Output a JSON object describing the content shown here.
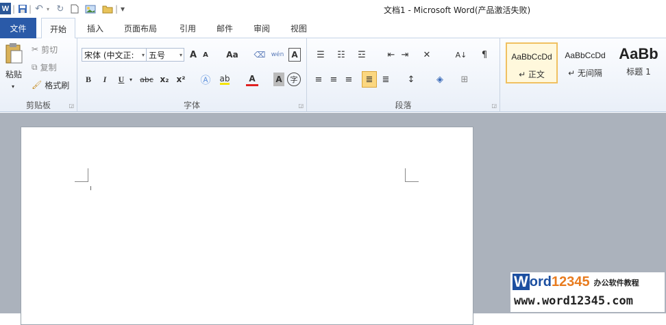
{
  "window": {
    "title": "文档1 - Microsoft Word(产品激活失败)"
  },
  "quick_access": {
    "logo": "W",
    "separator": "|",
    "customize": "▾"
  },
  "tabs": {
    "file": "文件",
    "home": "开始",
    "insert": "插入",
    "layout": "页面布局",
    "references": "引用",
    "mailings": "邮件",
    "review": "审阅",
    "view": "视图"
  },
  "clipboard": {
    "paste": "粘贴",
    "cut": "剪切",
    "copy": "复制",
    "format_painter": "格式刷",
    "label": "剪贴板"
  },
  "font": {
    "name": "宋体 (中文正:",
    "size": "五号",
    "grow": "A",
    "shrink": "A",
    "case": "Aa",
    "label": "字体",
    "bold": "B",
    "italic": "I",
    "underline": "U",
    "strike": "abc",
    "sub": "x₂",
    "sup": "x²",
    "phonetic": "wén",
    "char_border": "A",
    "font_color": "A",
    "char_shade": "A",
    "enclose": "字"
  },
  "paragraph": {
    "label": "段落",
    "sort": "A↓"
  },
  "styles": [
    {
      "sample": "AaBbCcDd",
      "name": "↵ 正文"
    },
    {
      "sample": "AaBbCcDd",
      "name": "↵ 无间隔"
    },
    {
      "sample": "AaBb",
      "name": "标题 1"
    }
  ],
  "watermark": {
    "brand_letter": "W",
    "brand_rest": "ord",
    "brand_num": "12345",
    "tagline": "办公软件教程",
    "url": "www.word12345.com"
  },
  "colors": {
    "file_tab": "#2a5aa8",
    "brand_blue": "#1c4fa0",
    "brand_orange": "#e87b1e"
  }
}
